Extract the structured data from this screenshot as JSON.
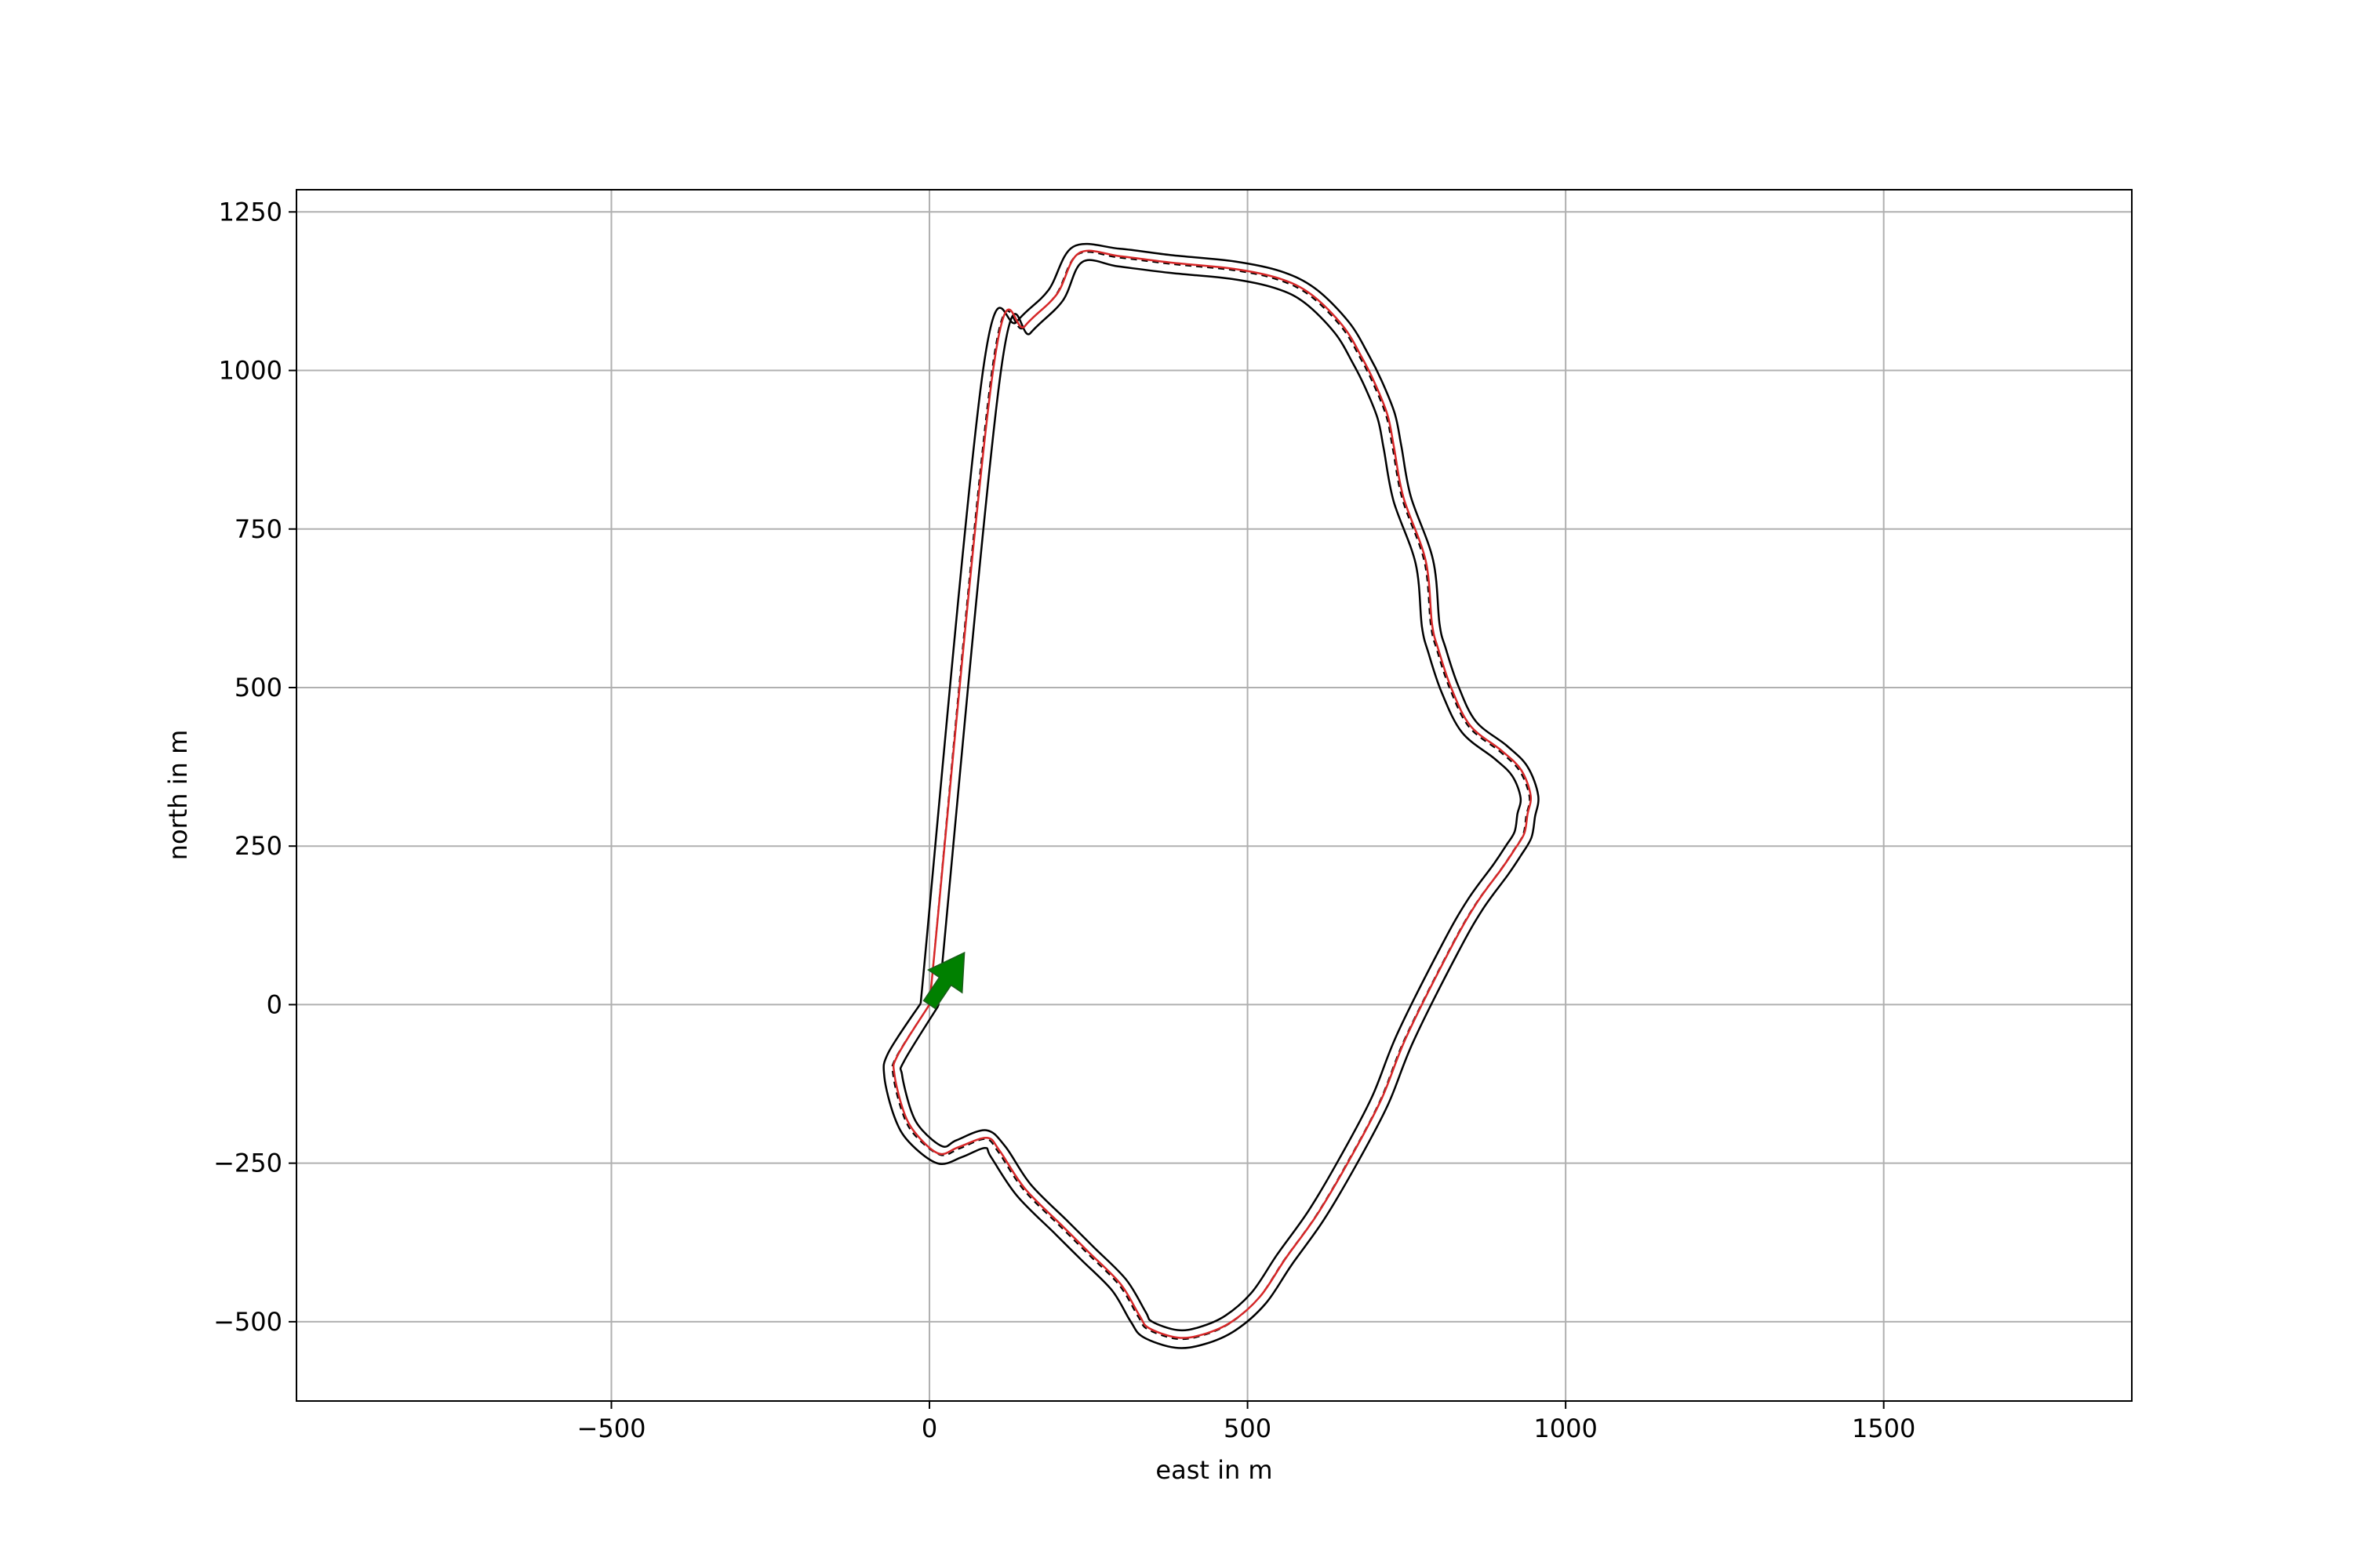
{
  "chart_data": {
    "type": "line",
    "title": "",
    "xlabel": "east in m",
    "ylabel": "north in m",
    "xlim": [
      -995,
      1890
    ],
    "ylim": [
      -625,
      1285
    ],
    "xticks": [
      -500,
      0,
      500,
      1000,
      1500
    ],
    "yticks": [
      -500,
      -250,
      0,
      250,
      500,
      750,
      1000,
      1250
    ],
    "xtick_labels": [
      "−500",
      "0",
      "500",
      "1000",
      "1500"
    ],
    "ytick_labels": [
      "−500",
      "−250",
      "0",
      "250",
      "500",
      "750",
      "1000",
      "1250"
    ],
    "grid": true,
    "aspect": "equal",
    "colors": {
      "track_border": "#000000",
      "racing_line": "#d62728",
      "centerline": "#000000",
      "start_arrow": "#008000",
      "grid": "#b0b0b0"
    },
    "start_arrow": {
      "from": [
        0,
        0
      ],
      "to": [
        55,
        82
      ]
    },
    "series": [
      {
        "role": "racing_line",
        "x": [
          0,
          -50,
          -55,
          -40,
          -20,
          15,
          45,
          90,
          110,
          150,
          210,
          250,
          300,
          330,
          345,
          390,
          430,
          475,
          520,
          560,
          610,
          660,
          710,
          750,
          820,
          860,
          900,
          920,
          935,
          940,
          945,
          930,
          900,
          850,
          820,
          800,
          790,
          780,
          745,
          730,
          720,
          700,
          680,
          650,
          600,
          550,
          480,
          380,
          300,
          235,
          200,
          150,
          100,
          0
        ],
        "y": [
          0,
          -80,
          -110,
          -170,
          -205,
          -235,
          -225,
          -210,
          -230,
          -290,
          -350,
          -390,
          -440,
          -490,
          -510,
          -525,
          -520,
          -500,
          -460,
          -400,
          -330,
          -245,
          -150,
          -50,
          90,
          160,
          215,
          245,
          270,
          300,
          330,
          370,
          400,
          440,
          500,
          560,
          600,
          700,
          800,
          880,
          930,
          980,
          1020,
          1070,
          1120,
          1145,
          1160,
          1170,
          1180,
          1185,
          1120,
          1070,
          1000,
          0
        ]
      },
      {
        "role": "centerline",
        "x": [
          0,
          -52,
          -57,
          -42,
          -22,
          17,
          47,
          88,
          108,
          148,
          208,
          248,
          298,
          328,
          343,
          388,
          428,
          473,
          518,
          558,
          608,
          658,
          708,
          748,
          818,
          858,
          898,
          918,
          933,
          938,
          943,
          928,
          898,
          848,
          818,
          798,
          788,
          778,
          743,
          728,
          718,
          698,
          678,
          648,
          598,
          548,
          478,
          378,
          298,
          233,
          198,
          148,
          98,
          0
        ],
        "y": [
          0,
          -82,
          -112,
          -172,
          -207,
          -237,
          -227,
          -212,
          -232,
          -292,
          -352,
          -392,
          -442,
          -492,
          -512,
          -527,
          -522,
          -502,
          -462,
          -402,
          -332,
          -247,
          -152,
          -52,
          88,
          158,
          213,
          243,
          268,
          298,
          328,
          368,
          398,
          438,
          498,
          558,
          598,
          698,
          798,
          878,
          928,
          978,
          1018,
          1068,
          1118,
          1143,
          1158,
          1168,
          1178,
          1183,
          1118,
          1068,
          998,
          0
        ]
      }
    ]
  }
}
